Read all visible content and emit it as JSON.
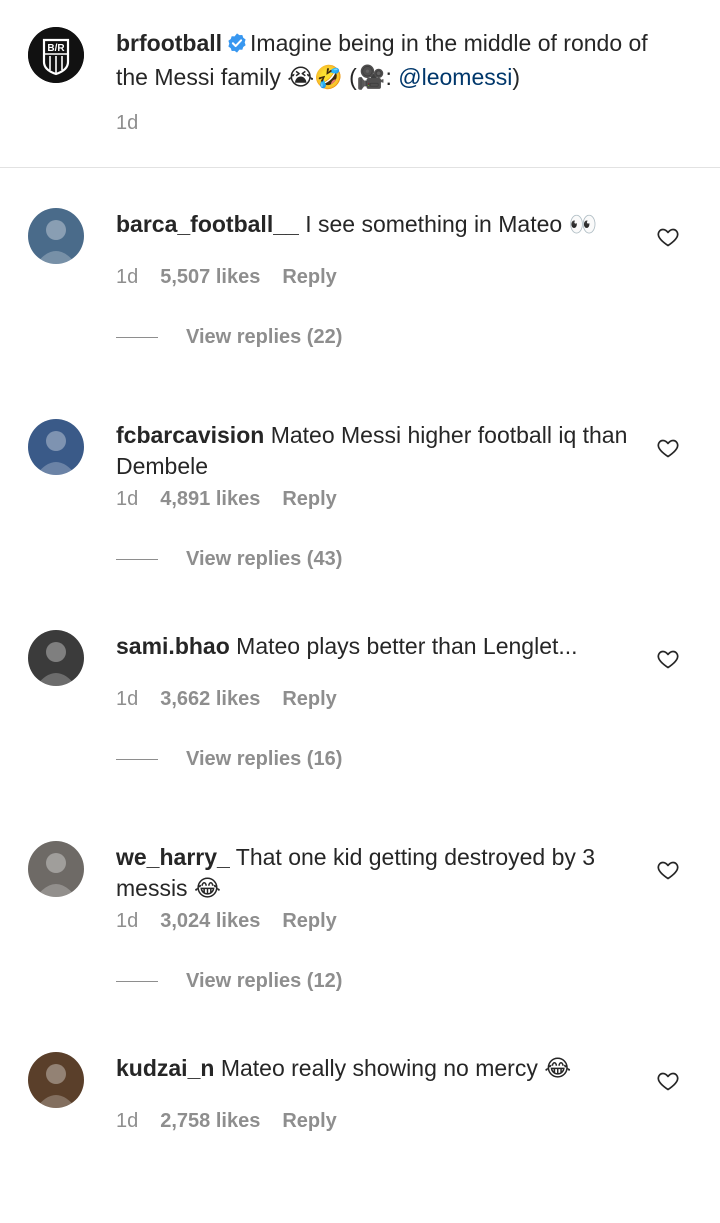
{
  "post": {
    "username": "brfootball",
    "avatar_text": "B/R",
    "caption_pre": "Imagine being in the middle of rondo of the Messi family 😭🤣 (🎥: ",
    "mention": "@leomessi",
    "caption_post": ")",
    "time": "1d"
  },
  "comments": [
    {
      "username": "barca_football__",
      "text": "I see something in Mateo 👀",
      "time": "1d",
      "likes": "5,507 likes",
      "reply": "Reply",
      "view_replies": "View replies (22)",
      "avatar_color": "#4a6b8a"
    },
    {
      "username": "fcbarcavision",
      "text": "Mateo Messi higher football iq than Dembele",
      "time": "1d",
      "likes": "4,891 likes",
      "reply": "Reply",
      "view_replies": "View replies (43)",
      "avatar_color": "#3a5a88"
    },
    {
      "username": "sami.bhao",
      "text": "Mateo plays better than Lenglet...",
      "time": "1d",
      "likes": "3,662 likes",
      "reply": "Reply",
      "view_replies": "View replies (16)",
      "avatar_color": "#3b3b3b"
    },
    {
      "username": "we_harry_",
      "text": "That one kid getting destroyed by 3 messis 😂",
      "time": "1d",
      "likes": "3,024 likes",
      "reply": "Reply",
      "view_replies": "View replies (12)",
      "avatar_color": "#6e6a66"
    },
    {
      "username": "kudzai_n",
      "text": "Mateo really showing no mercy 😂",
      "time": "1d",
      "likes": "2,758 likes",
      "reply": "Reply",
      "view_replies": "",
      "avatar_color": "#5a3f2a"
    }
  ],
  "colors": {
    "verified": "#3897f0",
    "mention": "#00376b",
    "secondary_text": "#8e8e8e"
  },
  "icons": {
    "heart": "heart-outline-icon",
    "verified": "verified-badge-icon"
  }
}
